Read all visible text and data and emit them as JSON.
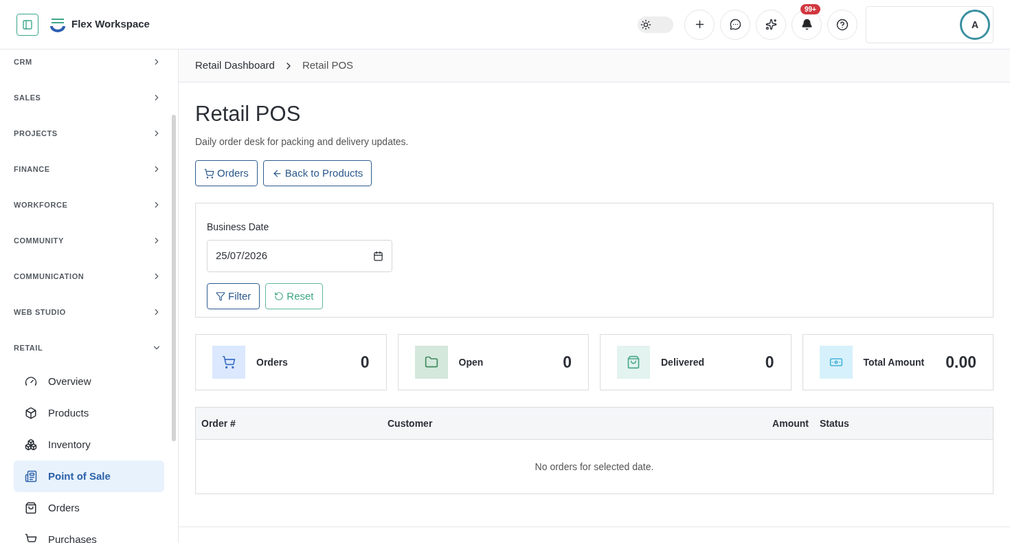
{
  "header": {
    "brand": "Flex Workspace",
    "theme_toggle": {
      "on": false
    },
    "notification_badge": "99+",
    "avatar": "A"
  },
  "sidebar": {
    "sections": [
      {
        "label": "CRM",
        "expanded": false
      },
      {
        "label": "SALES",
        "expanded": false
      },
      {
        "label": "PROJECTS",
        "expanded": false
      },
      {
        "label": "FINANCE",
        "expanded": false
      },
      {
        "label": "WORKFORCE",
        "expanded": false
      },
      {
        "label": "COMMUNITY",
        "expanded": false
      },
      {
        "label": "COMMUNICATION",
        "expanded": false
      },
      {
        "label": "WEB STUDIO",
        "expanded": false
      },
      {
        "label": "RETAIL",
        "expanded": true,
        "children": [
          {
            "label": "Overview",
            "selected": false
          },
          {
            "label": "Products",
            "selected": false
          },
          {
            "label": "Inventory",
            "selected": false
          },
          {
            "label": "Point of Sale",
            "selected": true
          },
          {
            "label": "Orders",
            "selected": false
          },
          {
            "label": "Purchases",
            "selected": false
          }
        ]
      }
    ]
  },
  "breadcrumb": [
    "Retail Dashboard",
    "Retail POS"
  ],
  "page": {
    "title": "Retail POS",
    "subtitle": "Daily order desk for packing and delivery updates.",
    "actions": [
      "Orders",
      "Back to Products"
    ]
  },
  "filter": {
    "label": "Business Date",
    "value": "25/07/2026",
    "buttons": [
      "Filter",
      "Reset"
    ]
  },
  "stats": [
    {
      "label": "Orders",
      "value": "0",
      "color": "#dbe8fd"
    },
    {
      "label": "Open",
      "value": "0",
      "color": "#d4e8dc"
    },
    {
      "label": "Delivered",
      "value": "0",
      "color": "#e3f3ef"
    },
    {
      "label": "Total Amount",
      "value": "0.00",
      "color": "#d6f1fb"
    }
  ],
  "table": {
    "columns": [
      "Order #",
      "Customer",
      "Amount",
      "Status"
    ],
    "empty_message": "No orders for selected date."
  }
}
